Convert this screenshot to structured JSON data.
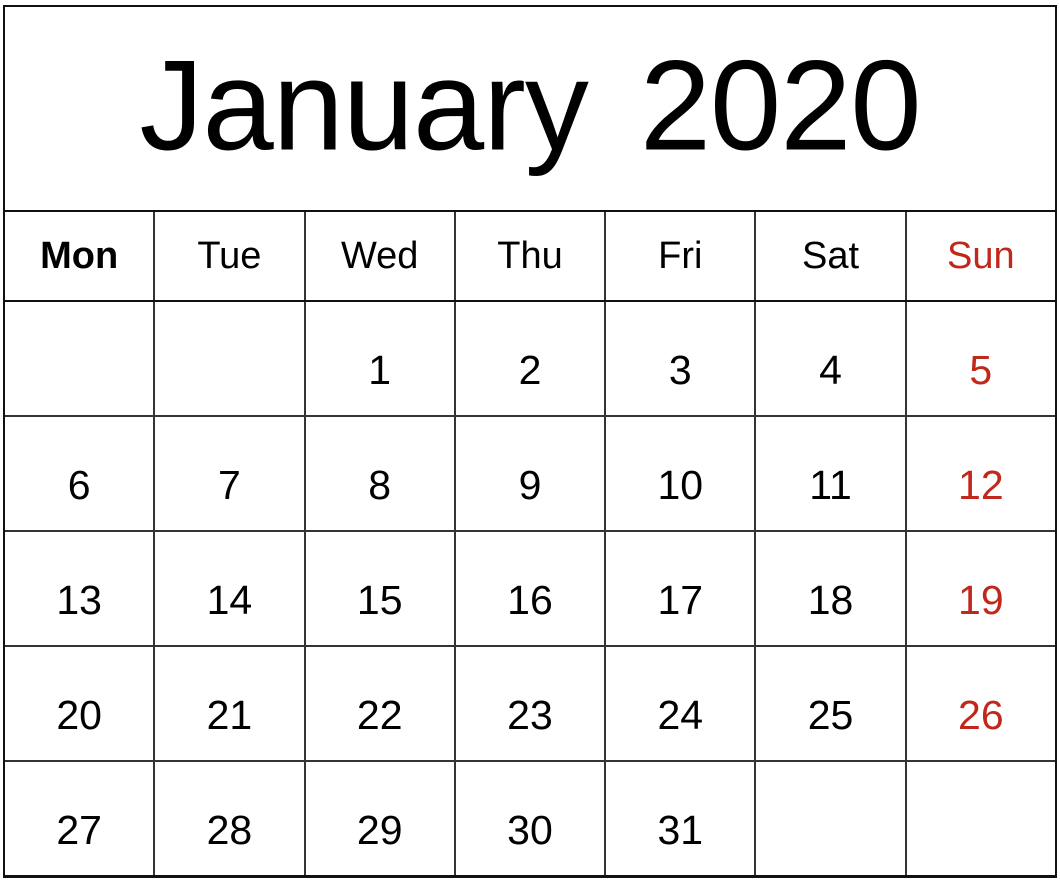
{
  "calendar": {
    "month_name": "January",
    "year": "2020",
    "title_full": "January 2020",
    "colors": {
      "text": "#000000",
      "sunday_accent": "#C0281C",
      "grid_line": "#333333",
      "outer_border": "#111111",
      "background": "#FFFFFF"
    },
    "weekdays": [
      {
        "label": "Mon",
        "is_weekend": false,
        "is_sunday": false
      },
      {
        "label": "Tue",
        "is_weekend": false,
        "is_sunday": false
      },
      {
        "label": "Wed",
        "is_weekend": false,
        "is_sunday": false
      },
      {
        "label": "Thu",
        "is_weekend": false,
        "is_sunday": false
      },
      {
        "label": "Fri",
        "is_weekend": false,
        "is_sunday": false
      },
      {
        "label": "Sat",
        "is_weekend": true,
        "is_sunday": false
      },
      {
        "label": "Sun",
        "is_weekend": true,
        "is_sunday": true
      }
    ],
    "weeks": [
      {
        "days": [
          "",
          "",
          "1",
          "2",
          "3",
          "4",
          "5"
        ]
      },
      {
        "days": [
          "6",
          "7",
          "8",
          "9",
          "10",
          "11",
          "12"
        ]
      },
      {
        "days": [
          "13",
          "14",
          "15",
          "16",
          "17",
          "18",
          "19"
        ]
      },
      {
        "days": [
          "20",
          "21",
          "22",
          "23",
          "24",
          "25",
          "26"
        ]
      },
      {
        "days": [
          "27",
          "28",
          "29",
          "30",
          "31",
          "",
          ""
        ]
      }
    ]
  }
}
